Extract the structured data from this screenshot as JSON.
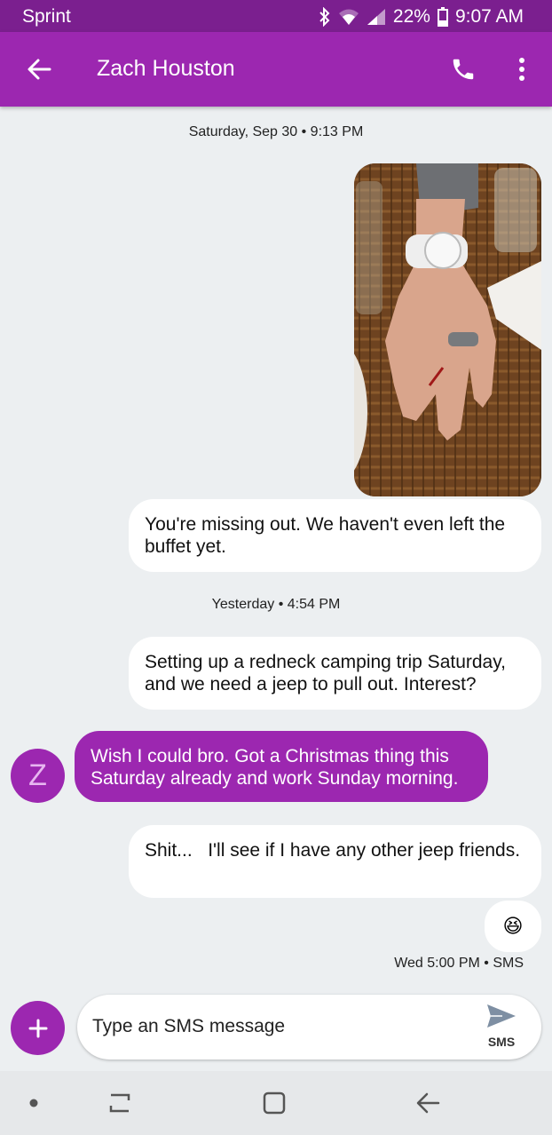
{
  "status": {
    "carrier": "Sprint",
    "battery": "22%",
    "time": "9:07 AM"
  },
  "header": {
    "title": "Zach Houston"
  },
  "conversation": {
    "ts1": "Saturday, Sep 30 • 9:13 PM",
    "msg1": "You're missing out. We haven't even left the buffet yet.",
    "ts2": "Yesterday • 4:54 PM",
    "msg2": "Setting up a redneck camping trip Saturday, and we need a jeep to pull out. Interest?",
    "avatar_letter": "Z",
    "msg3": "Wish I could bro. Got a Christmas thing this Saturday already and work Sunday morning.",
    "msg4": "Shit...   I'll see if I have any other jeep friends.",
    "emoji": "😆",
    "meta": "Wed 5:00 PM • SMS"
  },
  "compose": {
    "placeholder": "Type an SMS message",
    "send_label": "SMS"
  },
  "colors": {
    "accent": "#9c27b0",
    "status_bar": "#7b1f8f",
    "background": "#eceff1"
  }
}
